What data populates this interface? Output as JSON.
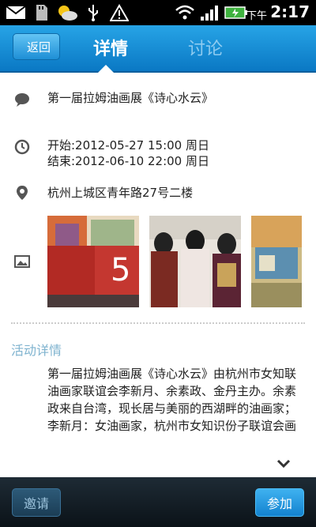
{
  "status_bar": {
    "ampm": "下午",
    "time": "2:17",
    "icons": [
      "mail-icon",
      "sd-card-icon",
      "weather-icon",
      "usb-icon",
      "warning-icon",
      "wifi-icon",
      "signal-icon",
      "battery-icon"
    ]
  },
  "header": {
    "back_label": "返回",
    "tabs": [
      {
        "label": "详情",
        "active": true
      },
      {
        "label": "讨论",
        "active": false
      }
    ]
  },
  "event": {
    "title": "第一届拉姆油画展《诗心水云》",
    "start": "开始:2012-05-27 15:00 周日",
    "end": "结束:2012-06-10 22:00 周日",
    "location": "杭州上城区青年路27号二楼",
    "photos": [
      "photo-1",
      "photo-2",
      "photo-3"
    ]
  },
  "details": {
    "section_title": "活动详情",
    "text": "第一届拉姆油画展《诗心水云》由杭州市女知联油画家联谊会李新月、余素政、金丹主办。余素政来自台湾，现长居与美丽的西湖畔的油画家；李新月：女油画家，杭州市女知识份子联谊会画"
  },
  "bottom_bar": {
    "invite_label": "邀请",
    "join_label": "参加"
  },
  "colors": {
    "header_blue": "#1a8fd6",
    "inactive_tab": "#8ecbf0",
    "section_title": "#7fb3cf",
    "bottom_bar": "#111a20"
  }
}
